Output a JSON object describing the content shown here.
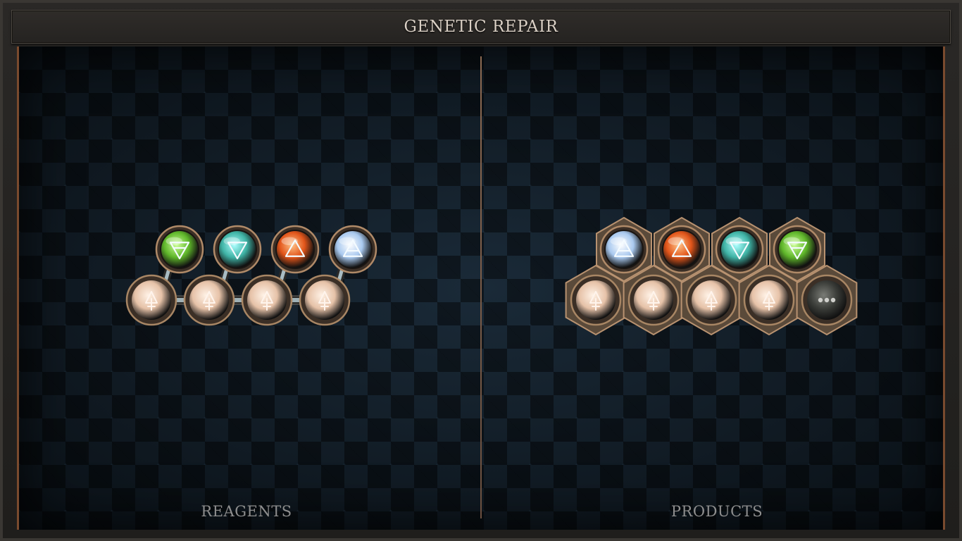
{
  "window": {
    "title": "GENETIC REPAIR"
  },
  "sections": {
    "reagents_label": "REAGENTS",
    "products_label": "PRODUCTS"
  },
  "reagents": {
    "orbs": [
      {
        "element": "earth",
        "icon": "earth-symbol-icon",
        "color": "#5fb62a"
      },
      {
        "element": "water",
        "icon": "water-symbol-icon",
        "color": "#3fb3a5"
      },
      {
        "element": "fire",
        "icon": "fire-symbol-icon",
        "color": "#e2551a"
      },
      {
        "element": "air",
        "icon": "air-symbol-icon",
        "color": "#a9c9ef"
      }
    ],
    "base_nodes": 4
  },
  "products": {
    "orbs": [
      {
        "element": "air",
        "icon": "air-symbol-icon",
        "color": "#a9c9ef"
      },
      {
        "element": "fire",
        "icon": "fire-symbol-icon",
        "color": "#e2551a"
      },
      {
        "element": "water",
        "icon": "water-symbol-icon",
        "color": "#3fb3a5"
      },
      {
        "element": "earth",
        "icon": "earth-symbol-icon",
        "color": "#5fb62a"
      }
    ],
    "base_nodes": 4,
    "extra_node": "more-icon"
  },
  "colors": {
    "frame": "#3a3733",
    "accent_wood": "#7a4a2e",
    "title_text": "#d9cfc4",
    "label_text": "#8e8e8e",
    "base_node": "#e6c2a8",
    "bronze": "#8a6a4a"
  }
}
